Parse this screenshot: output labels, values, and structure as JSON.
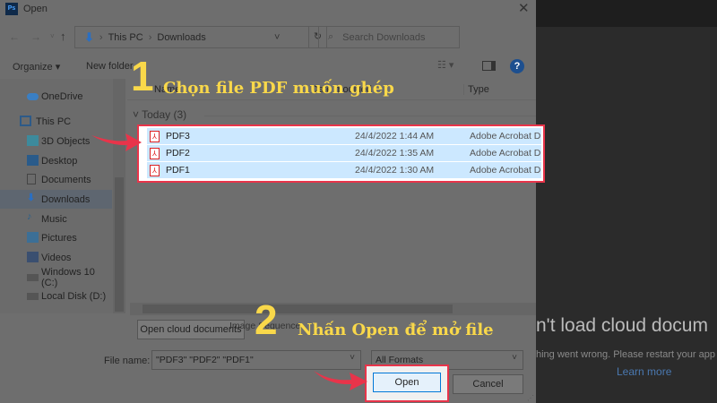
{
  "window": {
    "title": "Open",
    "app_icon": "Ps"
  },
  "nav": {
    "path": [
      "This PC",
      "Downloads"
    ],
    "search_placeholder": "Search Downloads"
  },
  "toolbar": {
    "organize": "Organize",
    "new_folder": "New folder"
  },
  "columns": {
    "name": "Name",
    "date": "Date modified",
    "type": "Type"
  },
  "sidebar": {
    "items": [
      {
        "label": "OneDrive",
        "icon": "cloud-icon"
      },
      {
        "label": "This PC",
        "icon": "computer-icon"
      },
      {
        "label": "3D Objects",
        "icon": "cube-icon"
      },
      {
        "label": "Desktop",
        "icon": "desktop-icon"
      },
      {
        "label": "Documents",
        "icon": "document-icon"
      },
      {
        "label": "Downloads",
        "icon": "download-icon"
      },
      {
        "label": "Music",
        "icon": "music-icon"
      },
      {
        "label": "Pictures",
        "icon": "picture-icon"
      },
      {
        "label": "Videos",
        "icon": "video-icon"
      },
      {
        "label": "Windows 10 (C:)",
        "icon": "drive-icon"
      },
      {
        "label": "Local Disk (D:)",
        "icon": "drive-icon"
      }
    ]
  },
  "group": {
    "label": "Today (3)"
  },
  "files": [
    {
      "name": "PDF3",
      "date": "24/4/2022 1:44 AM",
      "type": "Adobe Acrobat D"
    },
    {
      "name": "PDF2",
      "date": "24/4/2022 1:35 AM",
      "type": "Adobe Acrobat D"
    },
    {
      "name": "PDF1",
      "date": "24/4/2022 1:30 AM",
      "type": "Adobe Acrobat D"
    }
  ],
  "bottom": {
    "cloud_button": "Open cloud documents",
    "image_sequence": "Image Sequence",
    "file_name_label": "File name:",
    "file_name_value": "\"PDF3\" \"PDF2\" \"PDF1\"",
    "format": "All Formats",
    "open": "Open",
    "cancel": "Cancel"
  },
  "annotations": {
    "step1_num": "1",
    "step1_text": "Chọn file PDF muốn ghép",
    "step2_num": "2",
    "step2_text": "Nhấn Open để mở file"
  },
  "background_app": {
    "heading": "n't load cloud docum",
    "message": "hing went wrong. Please restart your app",
    "link": "Learn more"
  },
  "colors": {
    "accent": "#f9d84a",
    "highlight": "#e8344a",
    "selection": "#cce8ff"
  }
}
